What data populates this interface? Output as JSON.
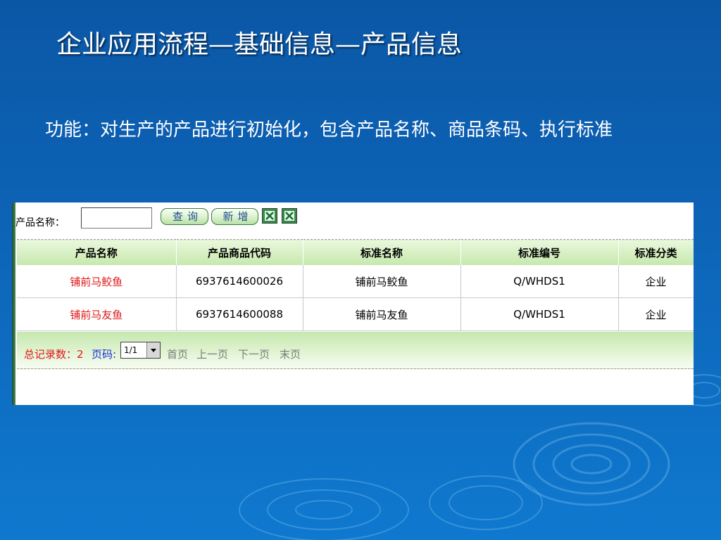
{
  "slide": {
    "title": "企业应用流程—基础信息—产品信息",
    "description": "功能：对生产的产品进行初始化，包含产品名称、商品条码、执行标准"
  },
  "search": {
    "label": "产品名称：",
    "input_value": "",
    "query_button": "查询",
    "add_button": "新增"
  },
  "icons": [
    "excel-export-icon",
    "excel-import-icon",
    "chevron-down-icon"
  ],
  "table": {
    "columns": [
      "产品名称",
      "产品商品代码",
      "标准名称",
      "标准编号",
      "标准分类"
    ],
    "rows": [
      [
        "铺前马鲛鱼",
        "6937614600026",
        "铺前马鲛鱼",
        "Q/WHDS1",
        "企业"
      ],
      [
        "铺前马友鱼",
        "6937614600088",
        "铺前马友鱼",
        "Q/WHDS1",
        "企业"
      ]
    ]
  },
  "pager": {
    "total_label": "总记录数：2",
    "page_label": "页码:",
    "page_value": "1/1",
    "first": "首页",
    "prev": "上一页",
    "next": "下一页",
    "last": "末页"
  },
  "colors": {
    "background": "#0d63b6",
    "header_green": "#c5e8ac",
    "product_name_red": "#e0191a",
    "page_label_blue": "#1b2fd6",
    "nav_gray": "#7a7a7a"
  }
}
